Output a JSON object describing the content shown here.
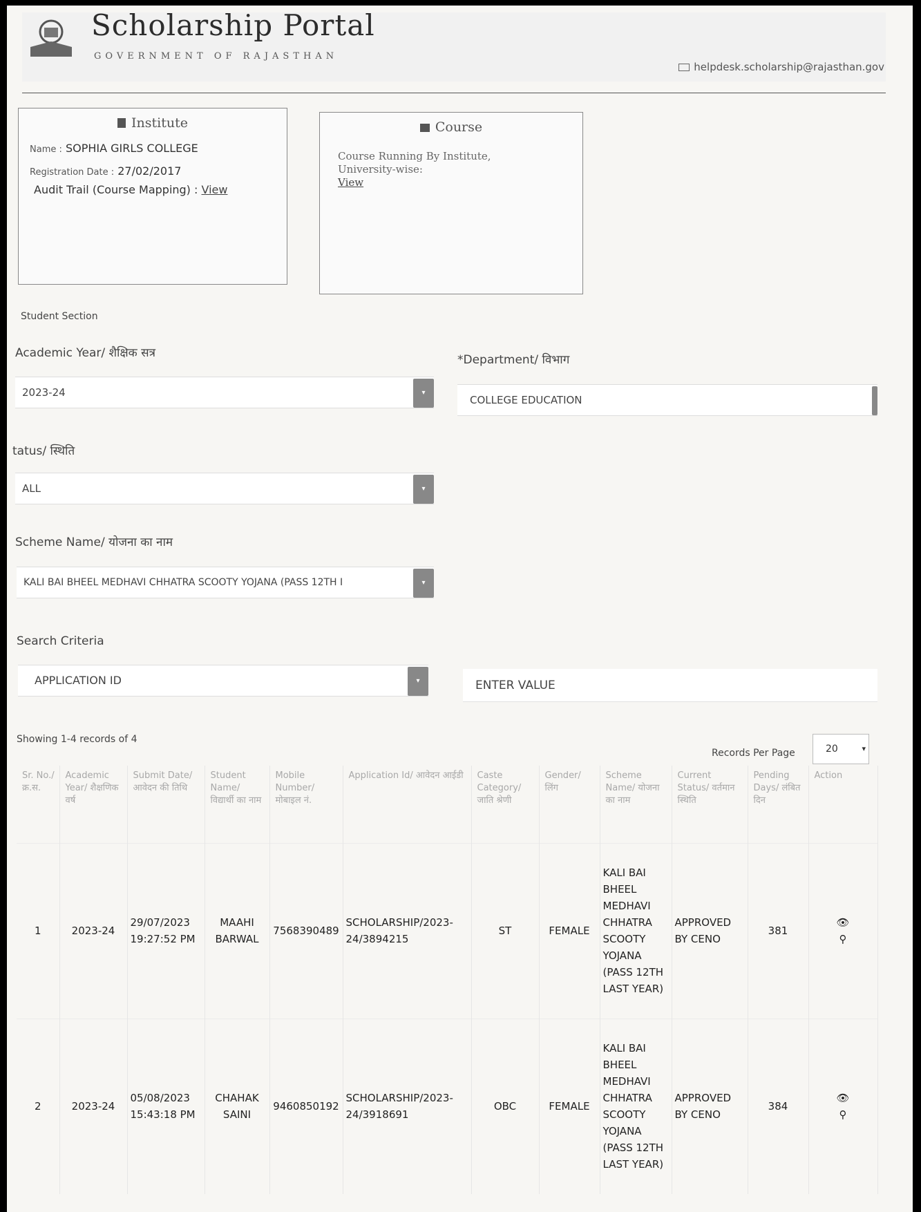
{
  "header": {
    "title": "Scholarship Portal",
    "subtitle": "GOVERNMENT OF RAJASTHAN",
    "email": "helpdesk.scholarship@rajasthan.gov"
  },
  "institute_card": {
    "heading": "Institute",
    "name_label": "Name :",
    "name_value": "SOPHIA GIRLS COLLEGE",
    "reg_label": "Registration Date :",
    "reg_value": "27/02/2017",
    "audit_label": "Audit Trail (Course Mapping) :",
    "audit_link": "View"
  },
  "course_card": {
    "heading": "Course",
    "text": "Course Running By Institute, University-wise:",
    "link": "View"
  },
  "student_section": "Student Section",
  "filters": {
    "academic_year_label": "Academic Year/ शैक्षिक सत्र",
    "academic_year_value": "2023-24",
    "department_label": "*Department/ विभाग",
    "department_value": "COLLEGE EDUCATION",
    "status_label": "tatus/ स्थिति",
    "status_value": "ALL",
    "scheme_label": "Scheme Name/ योजना का नाम",
    "scheme_value": "KALI BAI BHEEL MEDHAVI CHHATRA SCOOTY YOJANA (PASS 12TH I",
    "search_label": "Search Criteria",
    "search_value": "APPLICATION ID",
    "search_input_placeholder": "ENTER VALUE"
  },
  "results": {
    "showing": "Showing 1-4 records of 4",
    "rpp_label": "Records Per Page",
    "rpp_value": "20",
    "columns": [
      "Sr. No./ क्र.स.",
      "Academic Year/ शैक्षणिक वर्ष",
      "Submit Date/ आवेदन की तिथि",
      "Student Name/ विद्यार्थी का नाम",
      "Mobile Number/ मोबाइल नं.",
      "Application Id/ आवेदन आईडी",
      "Caste Category/ जाति श्रेणी",
      "Gender/ लिंग",
      "Scheme Name/ योजना का नाम",
      "Current Status/ वर्तमान स्थिति",
      "Pending Days/ लंबित दिन",
      "Action"
    ],
    "rows": [
      {
        "sr": "1",
        "year": "2023-24",
        "date": "29/07/2023 19:27:52 PM",
        "name": "MAAHI BARWAL",
        "mobile": "7568390489",
        "app_id": "SCHOLARSHIP/2023-24/3894215",
        "caste": "ST",
        "gender": "FEMALE",
        "scheme": "KALI BAI BHEEL MEDHAVI CHHATRA SCOOTY YOJANA (PASS 12TH LAST YEAR)",
        "status": "APPROVED BY CENO",
        "pending": "381"
      },
      {
        "sr": "2",
        "year": "2023-24",
        "date": "05/08/2023 15:43:18 PM",
        "name": "CHAHAK SAINI",
        "mobile": "9460850192",
        "app_id": "SCHOLARSHIP/2023-24/3918691",
        "caste": "OBC",
        "gender": "FEMALE",
        "scheme": "KALI BAI BHEEL MEDHAVI CHHATRA SCOOTY YOJANA (PASS 12TH LAST YEAR)",
        "status": "APPROVED BY CENO",
        "pending": "384"
      }
    ]
  }
}
